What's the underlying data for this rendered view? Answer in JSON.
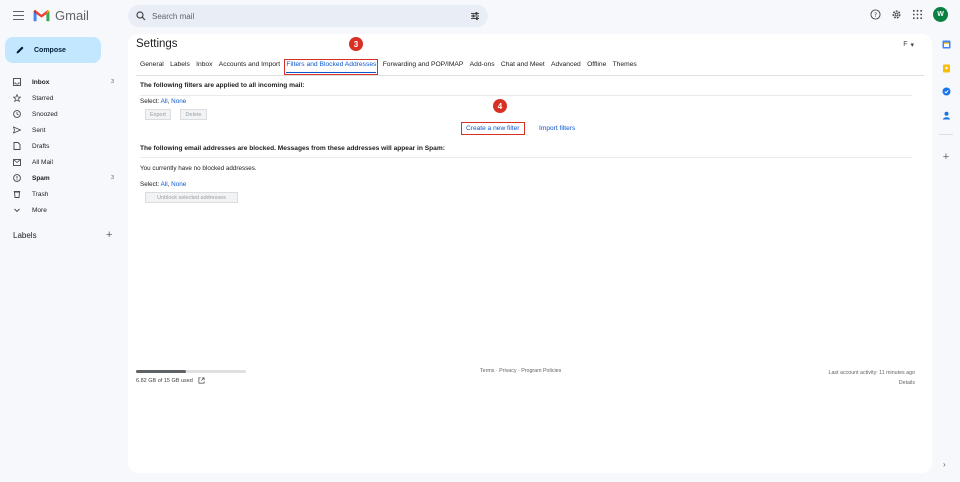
{
  "app": {
    "name": "Gmail",
    "avatar_letter": "W"
  },
  "search": {
    "placeholder": "Search mail"
  },
  "compose": {
    "label": "Compose"
  },
  "nav": [
    {
      "label": "Inbox",
      "count": "3",
      "bold": true,
      "icon": "inbox-icon"
    },
    {
      "label": "Starred",
      "count": "",
      "bold": false,
      "icon": "star-icon"
    },
    {
      "label": "Snoozed",
      "count": "",
      "bold": false,
      "icon": "clock-icon"
    },
    {
      "label": "Sent",
      "count": "",
      "bold": false,
      "icon": "send-icon"
    },
    {
      "label": "Drafts",
      "count": "",
      "bold": false,
      "icon": "draft-icon"
    },
    {
      "label": "All Mail",
      "count": "",
      "bold": false,
      "icon": "all-mail-icon"
    },
    {
      "label": "Spam",
      "count": "3",
      "bold": true,
      "icon": "spam-icon"
    },
    {
      "label": "Trash",
      "count": "",
      "bold": false,
      "icon": "trash-icon"
    },
    {
      "label": "More",
      "count": "",
      "bold": false,
      "icon": "chevron-down-icon"
    }
  ],
  "labels_section": {
    "title": "Labels",
    "add": "+"
  },
  "settings": {
    "title": "Settings",
    "input_tools": "F",
    "tabs": [
      "General",
      "Labels",
      "Inbox",
      "Accounts and Import",
      "Filters and Blocked Addresses",
      "Forwarding and POP/IMAP",
      "Add-ons",
      "Chat and Meet",
      "Advanced",
      "Offline",
      "Themes"
    ],
    "active_tab_index": 4,
    "filters": {
      "heading": "The following filters are applied to all incoming mail:",
      "select_prefix": "Select:",
      "select_all": "All",
      "select_sep": ",",
      "select_none": "None",
      "export": "Export",
      "delete": "Delete",
      "create_filter": "Create a new filter",
      "import_filters": "Import filters"
    },
    "blocked": {
      "heading": "The following email addresses are blocked. Messages from these addresses will appear in Spam:",
      "empty": "You currently have no blocked addresses.",
      "select_prefix": "Select:",
      "select_all": "All",
      "select_sep": ",",
      "select_none": "None",
      "unblock": "Unblock selected addresses"
    }
  },
  "annotations": {
    "step_tab": "3",
    "step_filter": "4"
  },
  "footer": {
    "storage_text": "6.82 GB of 15 GB used",
    "storage_fraction": 0.455,
    "terms": "Terms",
    "dot1": " · ",
    "privacy": "Privacy",
    "dot2": " · ",
    "policies": "Program Policies",
    "last_activity": "Last account activity: 11 minutes ago",
    "details": "Details"
  },
  "colors": {
    "accent": "#0b57d0",
    "annotation": "#d93025",
    "compose_bg": "#c2e7ff"
  }
}
